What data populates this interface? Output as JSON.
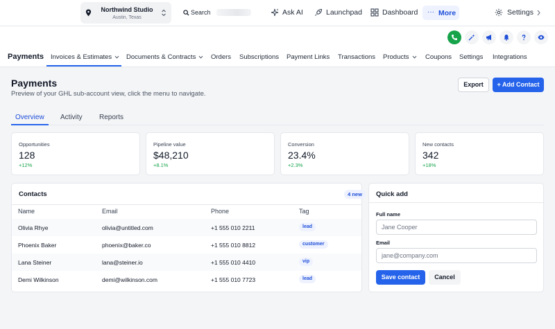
{
  "location": {
    "name": "Northwind Studio",
    "city": "Austin, Texas"
  },
  "search": {
    "placeholder": "Search"
  },
  "topnav": {
    "ask_ai": "Ask AI",
    "launchpad": "Launchpad",
    "dashboard": "Dashboard",
    "more": "More",
    "settings": "Settings"
  },
  "subnav": {
    "title": "Payments",
    "items": [
      "Invoices & Estimates",
      "Documents & Contracts",
      "Orders",
      "Subscriptions",
      "Payment Links",
      "Transactions",
      "Products",
      "Coupons",
      "Settings",
      "Integrations"
    ]
  },
  "page": {
    "title": "Payments",
    "description": "Preview of your GHL sub-account view, click the menu to navigate.",
    "export_label": "Export",
    "add_label": "+ Add Contact"
  },
  "tabs": [
    "Overview",
    "Activity",
    "Reports"
  ],
  "stats": [
    {
      "label": "Opportunities",
      "value": "128",
      "delta": "+12%"
    },
    {
      "label": "Pipeline value",
      "value": "$48,210",
      "delta": "+8.1%"
    },
    {
      "label": "Conversion",
      "value": "23.4%",
      "delta": "+2.3%"
    },
    {
      "label": "New contacts",
      "value": "342",
      "delta": "+18%"
    }
  ],
  "contacts": {
    "title": "Contacts",
    "badge": "4 new",
    "columns": [
      "Name",
      "Email",
      "Phone",
      "Tag"
    ],
    "rows": [
      [
        "Olivia Rhye",
        "olivia@untitled.com",
        "+1 555 010 2211",
        "lead"
      ],
      [
        "Phoenix Baker",
        "phoenix@baker.co",
        "+1 555 010 8812",
        "customer"
      ],
      [
        "Lana Steiner",
        "lana@steiner.io",
        "+1 555 010 4410",
        "vip"
      ],
      [
        "Demi Wilkinson",
        "demi@wilkinson.com",
        "+1 555 010 7723",
        "lead"
      ]
    ]
  },
  "quick_add": {
    "title": "Quick add",
    "name_label": "Full name",
    "name_placeholder": "Jane Cooper",
    "email_label": "Email",
    "email_placeholder": "jane@company.com",
    "save_label": "Save contact",
    "cancel_label": "Cancel"
  },
  "colors": {
    "accent": "#2563eb",
    "positive": "#16a34a",
    "phone": "#16a34a"
  },
  "icons": [
    "location-pin-icon",
    "chevron-updown-icon",
    "search-icon",
    "sparkle-icon",
    "rocket-icon",
    "grid-icon",
    "dots-icon",
    "gear-icon",
    "chevron-right-icon",
    "phone-icon",
    "magic-wand-icon",
    "megaphone-icon",
    "bell-icon",
    "help-icon",
    "eye-icon",
    "chevron-down-icon"
  ]
}
